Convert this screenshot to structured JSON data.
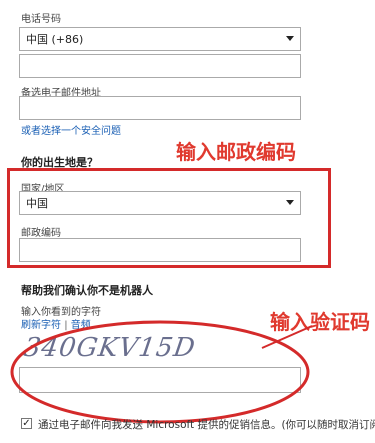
{
  "phone": {
    "label": "电话号码",
    "country_code": "中国 (+86)",
    "number_value": ""
  },
  "backup_email": {
    "label": "备选电子邮件地址",
    "value": ""
  },
  "security_link": "或者选择一个安全问题",
  "birthplace": {
    "heading": "你的出生地是？",
    "country_label": "国家/地区",
    "country_value": "中国",
    "postal_label": "邮政编码",
    "postal_value": ""
  },
  "annotation_postal": "输入邮政编码",
  "captcha": {
    "heading": "帮助我们确认你不是机器人",
    "instruction": "输入你看到的字符",
    "new_link": "刷新字符",
    "separator": "|",
    "audio_link": "音频",
    "image_text": "340GKV15D",
    "input_value": ""
  },
  "annotation_captcha": "输入验证码",
  "promo": {
    "checked": true,
    "check_glyph": "✓",
    "text": "通过电子邮件向我发送 Microsoft 提供的促销信息。(你可以随时取消订阅。)"
  },
  "colors": {
    "annotation_red": "#e03a2f",
    "link_blue": "#1a5fb4"
  }
}
